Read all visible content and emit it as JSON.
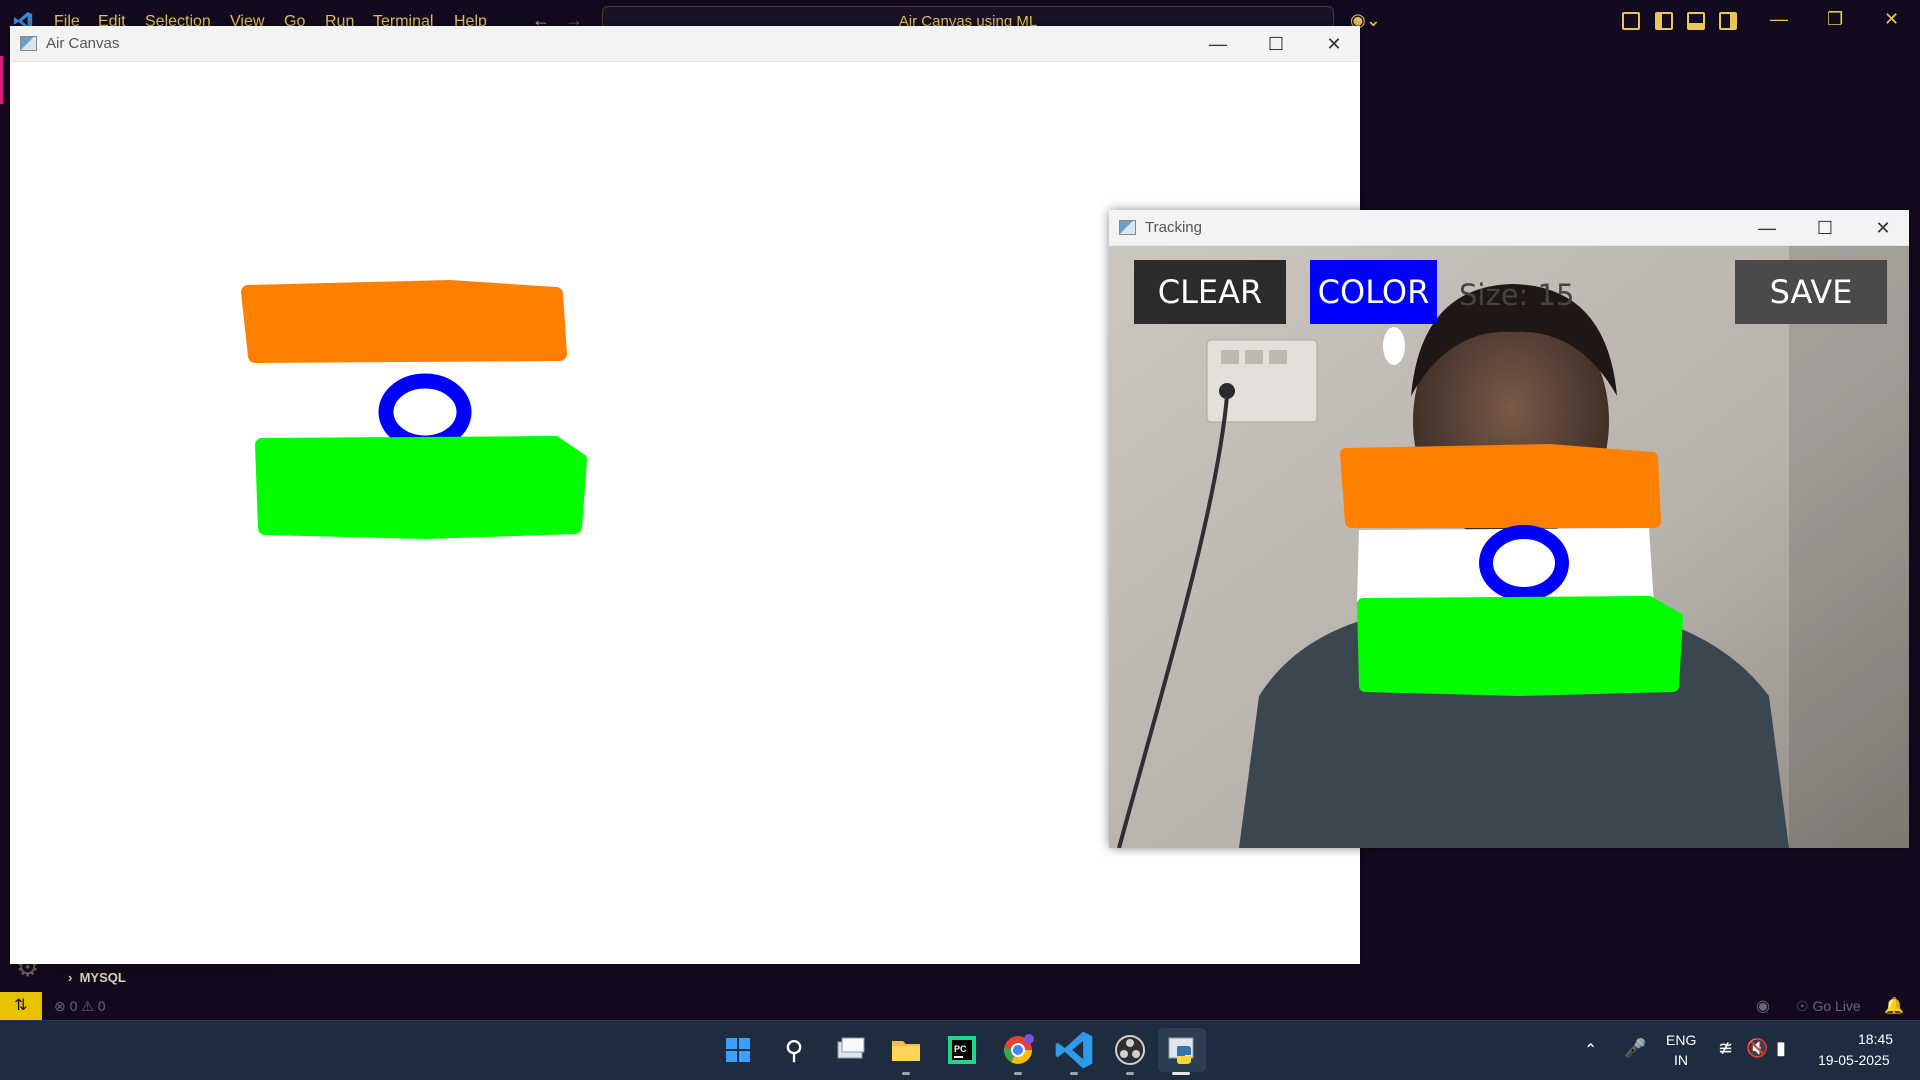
{
  "vscode": {
    "menu": [
      "File",
      "Edit",
      "Selection",
      "View",
      "Go",
      "Run",
      "Terminal",
      "Help"
    ],
    "search": "Air Canvas using ML",
    "sidebar_item": "MYSQL",
    "problems": "⊗ 0 ⚠ 0",
    "go_live": "Go Live"
  },
  "canvas_window": {
    "title": "Air Canvas",
    "minimize": "—",
    "maximize": "☐",
    "close": "✕"
  },
  "tracking_window": {
    "title": "Tracking",
    "minimize": "—",
    "maximize": "☐",
    "close": "✕",
    "clear_label": "CLEAR",
    "color_label": "COLOR",
    "size_label": "Size: 15",
    "save_label": "SAVE"
  },
  "colors": {
    "saffron": "#ff8000",
    "white": "#ffffff",
    "green": "#00ff00",
    "chakra_blue": "#0000ff",
    "vscode_accent": "#e8c65a",
    "color_button": "#0000ff",
    "clear_button": "#2b2b2b",
    "save_button": "#4a4a4a"
  },
  "taskbar": {
    "apps": [
      "windows-start",
      "search",
      "task-view",
      "file-explorer",
      "pycharm",
      "chrome",
      "vscode",
      "obs",
      "python"
    ],
    "lang_top": "ENG",
    "lang_bottom": "IN",
    "time": "18:45",
    "date": "19-05-2025"
  }
}
